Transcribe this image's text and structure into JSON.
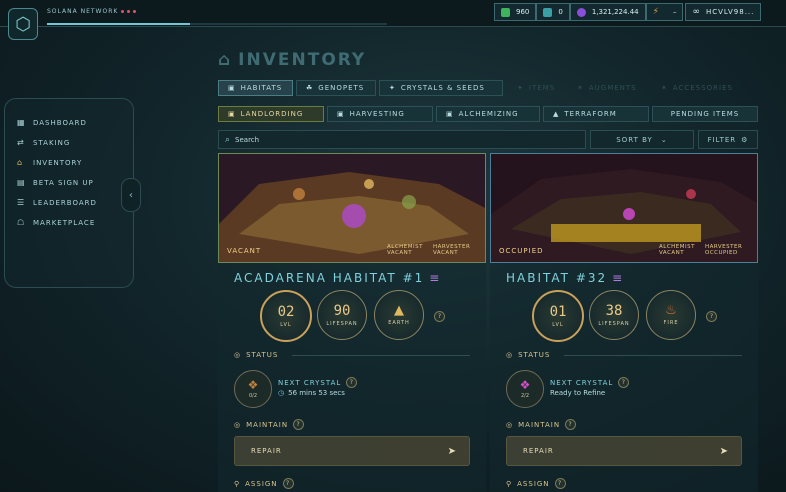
{
  "network": {
    "label": "SOLANA NETWORK",
    "progress": 0.42
  },
  "stats": [
    {
      "icon": "green-cube-icon",
      "value": "960",
      "color": "#3fb45a"
    },
    {
      "icon": "teal-cube-icon",
      "value": "0",
      "color": "#3aa0a8"
    },
    {
      "icon": "purple-coin-icon",
      "value": "1,321,224.44",
      "color": "#8a4fd8"
    },
    {
      "icon": "lightning-icon",
      "value": "–",
      "color": "#e0a040"
    }
  ],
  "wallet": {
    "label": "HCVLV98...",
    "icon": "link-icon"
  },
  "nav": [
    {
      "icon": "dashboard-icon",
      "glyph": "▦",
      "label": "DASHBOARD"
    },
    {
      "icon": "staking-icon",
      "glyph": "⇄",
      "label": "STAKING"
    },
    {
      "icon": "inventory-icon",
      "glyph": "⌂",
      "label": "INVENTORY"
    },
    {
      "icon": "beta-icon",
      "glyph": "▤",
      "label": "BETA SIGN UP"
    },
    {
      "icon": "leaderboard-icon",
      "glyph": "☰",
      "label": "LEADERBOARD"
    },
    {
      "icon": "marketplace-icon",
      "glyph": "☖",
      "label": "MARKETPLACE"
    }
  ],
  "page_title": "INVENTORY",
  "tabs": [
    {
      "label": "HABITATS",
      "icon": "habitat-icon"
    },
    {
      "label": "GENOPETS",
      "icon": "genopet-icon"
    },
    {
      "label": "CRYSTALS & SEEDS",
      "icon": "crystal-icon"
    },
    {
      "label": "ITEMS",
      "icon": "items-icon"
    },
    {
      "label": "AUGMENTS",
      "icon": "augment-icon"
    },
    {
      "label": "ACCESSORIES",
      "icon": "accessory-icon"
    }
  ],
  "subtabs": [
    {
      "label": "LANDLORDING"
    },
    {
      "label": "HARVESTING"
    },
    {
      "label": "ALCHEMIZING"
    },
    {
      "label": "TERRAFORM"
    },
    {
      "label": "PENDING ITEMS"
    }
  ],
  "search": {
    "placeholder": "Search"
  },
  "sort_label": "SORT BY",
  "filter_label": "FILTER",
  "cards": [
    {
      "image_status": "VACANT",
      "alchemist": "ALCHEMIST\nVACANT",
      "harvester": "HARVESTER\nVACANT",
      "name": "ACADARENA HABITAT #1",
      "level": "02",
      "level_label": "LVL",
      "lifespan": "90",
      "lifespan_label": "LIFESPAN",
      "element_label": "EARTH",
      "status_label": "STATUS",
      "crystal_count": "0/2",
      "next_crystal_label": "NEXT CRYSTAL",
      "next_crystal_detail": "56 mins 53 secs",
      "maintain_label": "MAINTAIN",
      "repair_label": "REPAIR",
      "assign_label": "ASSIGN"
    },
    {
      "image_status": "OCCUPIED",
      "alchemist": "ALCHEMIST\nVACANT",
      "harvester": "HARVESTER\nOCCUPIED",
      "name": "HABITAT #32",
      "level": "01",
      "level_label": "LVL",
      "lifespan": "38",
      "lifespan_label": "LIFESPAN",
      "element_label": "FIRE",
      "status_label": "STATUS",
      "crystal_count": "2/2",
      "next_crystal_label": "NEXT CRYSTAL",
      "next_crystal_detail": "Ready to Refine",
      "maintain_label": "MAINTAIN",
      "repair_label": "REPAIR",
      "assign_label": "ASSIGN"
    }
  ]
}
